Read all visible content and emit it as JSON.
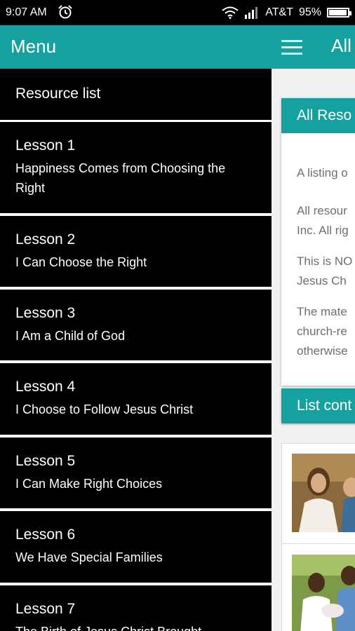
{
  "status_bar": {
    "time": "9:07 AM",
    "carrier": "AT&T",
    "battery": "95%",
    "battery_level": 0.95,
    "icons": [
      "alarm-icon",
      "wifi-icon",
      "signal-icon",
      "battery-icon"
    ]
  },
  "drawer": {
    "title": "Menu",
    "items": [
      {
        "title": "Resource list",
        "subtitle": ""
      },
      {
        "title": "Lesson 1",
        "subtitle": "Happiness Comes from Choosing the Right"
      },
      {
        "title": "Lesson 2",
        "subtitle": "I Can Choose the Right"
      },
      {
        "title": "Lesson 3",
        "subtitle": "I Am a Child of God"
      },
      {
        "title": "Lesson 4",
        "subtitle": "I Choose to Follow Jesus Christ"
      },
      {
        "title": "Lesson 5",
        "subtitle": "I Can Make Right Choices"
      },
      {
        "title": "Lesson 6",
        "subtitle": "We Have Special Families"
      },
      {
        "title": "Lesson 7",
        "subtitle": "The Birth of Jesus Christ Brought"
      }
    ]
  },
  "main": {
    "title": "All",
    "card1_header": "All Reso",
    "card1_paragraphs": [
      "A listing o",
      "All resour\nInc. All rig",
      "This is NO\nJesus Ch",
      "The mate\nchurch-re\notherwise"
    ],
    "card2_header": "List cont"
  },
  "colors": {
    "accent": "#16a1a1",
    "drawer_item_bg": "#000000",
    "divider": "#ffffff"
  }
}
